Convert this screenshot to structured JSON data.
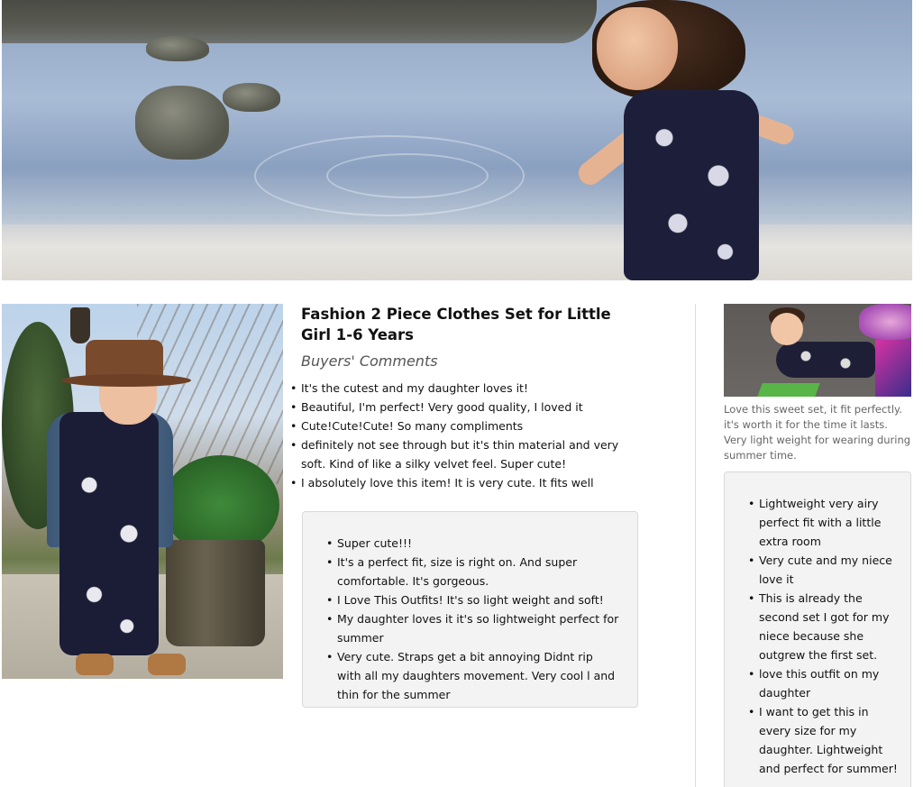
{
  "hero_image": {
    "alt": "hero-photo"
  },
  "product": {
    "title": "Fashion 2 Piece Clothes Set for Little Girl 1-6 Years",
    "section_subtitle": "Buyers' Comments"
  },
  "comments_main": [
    "It's the cutest and my daughter loves it!",
    "Beautiful, I'm perfect! Very good quality, I loved it",
    "Cute!Cute!Cute! So many compliments",
    "definitely not see through but it's thin material and very soft. Kind of like a silky velvet feel. Super cute!",
    "I absolutely love this item! It is very cute. It fits well"
  ],
  "comments_box": [
    "Super cute!!!",
    "It's a perfect fit, size is right on. And super comfortable. It's gorgeous.",
    "I Love This Outfits! It's so light weight and soft!",
    "My daughter loves it it's so lightweight perfect for summer",
    "Very cute. Straps get a bit annoying Didnt rip with all my daughters movement. Very cool l and thin for the summer"
  ],
  "sidebar": {
    "caption": "Love this sweet set, it fit perfectly. it's worth it for the time it lasts. Very light weight for wearing during summer time.",
    "comments": [
      "Lightweight very airy perfect fit with a little extra room",
      "Very cute and my niece love it",
      "This is already the second set I got for my niece because she outgrew the first set.",
      "love this outfit on my daughter",
      "I want to get this in every size for my daughter. Lightweight and perfect for summer!"
    ]
  },
  "colors": {
    "box_bg": "#f3f3f3",
    "box_border": "#d9d9d9",
    "subtitle": "#555555",
    "caption": "#666666"
  }
}
